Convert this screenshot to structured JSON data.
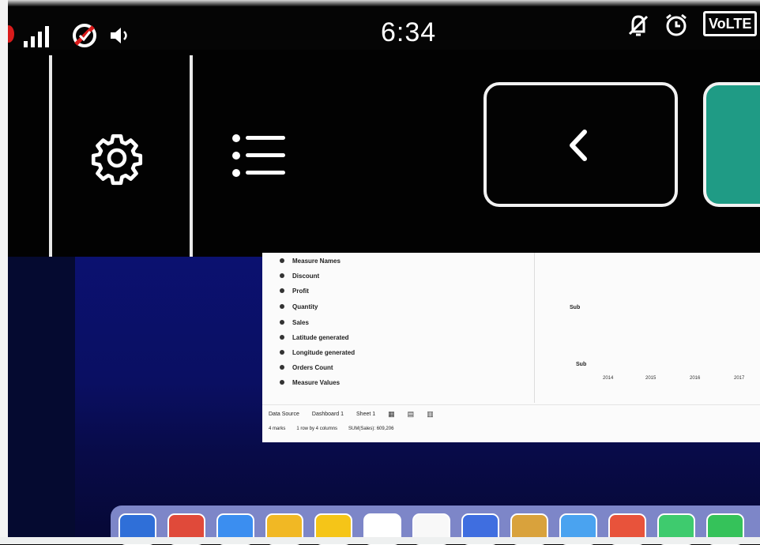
{
  "status_bar": {
    "time": "6:34",
    "network_label": "VoLTE",
    "icons": [
      "signal-icon",
      "data-saver-icon",
      "volume-icon",
      "mute-icon",
      "alarm-icon"
    ]
  },
  "toolbar": {
    "buttons": [
      "settings-gear-icon",
      "list-menu-icon",
      "back-chevron-icon",
      "next-button"
    ],
    "accent_color": "#1f9b85"
  },
  "screen": {
    "fields": [
      "Measure Names",
      "Discount",
      "Profit",
      "Quantity",
      "Sales",
      "Latitude generated",
      "Longitude generated",
      "Orders Count",
      "Measure Values"
    ],
    "chart_labels": [
      "Sub",
      "Sub"
    ],
    "x_ticks": [
      "2014",
      "2015",
      "2016",
      "2017"
    ],
    "tabs": [
      "Data Source",
      "Dashboard 1",
      "Sheet 1"
    ],
    "status_items": [
      "4 marks",
      "1 row by 4 columns",
      "SUM(Sales): 609,206"
    ]
  },
  "dock": {
    "colors": [
      "#2f6fd8",
      "#e04a3a",
      "#3b8ef0",
      "#f1b824",
      "#f5c518",
      "#ffffff",
      "#f8f8f8",
      "#3f6ee0",
      "#d9a23c",
      "#4aa3f0",
      "#e8533b",
      "#3ecb6e",
      "#35c25a"
    ]
  }
}
